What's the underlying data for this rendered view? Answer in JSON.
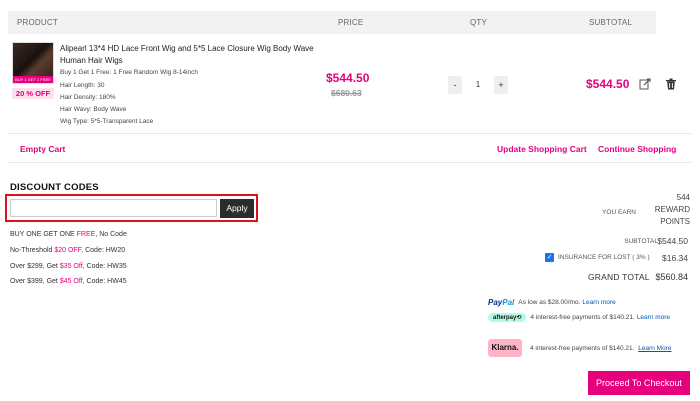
{
  "table": {
    "headers": [
      "PRODUCT",
      "PRICE",
      "QTY",
      "SUBTOTAL"
    ]
  },
  "product": {
    "name": "Alipearl 13*4 HD Lace Front Wig and 5*5 Lace Closure Wig Body Wave Human Hair Wigs",
    "image_ribbon": "BUY 1 GET 1 FREE",
    "discount_tag": "20 % OFF",
    "options": [
      "Buy 1 Get 1 Free: 1 Free Random Wig 8-14inch",
      "Hair Length: 30",
      "Hair Density: 180%",
      "Hair Wavy: Body Wave",
      "Wig Type: 5*5-Transparent Lace"
    ],
    "price": "$544.50",
    "original_price": "$680.63",
    "qty": "1",
    "qty_minus": "-",
    "qty_plus": "+",
    "subtotal": "$544.50",
    "icons": [
      "edit-icon",
      "trash-icon"
    ]
  },
  "actions": {
    "empty_cart": "Empty Cart",
    "update_cart": "Update Shopping Cart",
    "continue_shopping": "Continue Shopping"
  },
  "discount": {
    "title": "DISCOUNT CODES",
    "placeholder": "",
    "apply": "Apply",
    "promos": [
      {
        "pre": "BUY ONE GET ONE ",
        "hl": "FREE",
        "post": ", No Code"
      },
      {
        "pre": "No-Threshold ",
        "hl": "$20 OFF",
        "post": ", Code: HW20"
      },
      {
        "pre": "Over $299, Get ",
        "hl": "$35 Off",
        "post": ", Code: HW35"
      },
      {
        "pre": "Over $399, Get ",
        "hl": "$45 Off",
        "post": ", Code: HW45"
      }
    ]
  },
  "summary": {
    "reward_points": "544",
    "reward_text": "REWARD POINTS",
    "you_earn": "YOU EARN",
    "subtotal_label": "SUBTOTAL",
    "subtotal_value": "$544.50",
    "insurance_label": "INSURANCE FOR LOST ( 3% )",
    "insurance_value": "$16.34",
    "grand_total_label": "GRAND TOTAL",
    "grand_total_value": "$560.84"
  },
  "payments": {
    "paypal_brand_a": "Pay",
    "paypal_brand_b": "Pal",
    "paypal_text": "As low as $28.00/mo.",
    "afterpay_brand": "afterpay⟲",
    "afterpay_text": "4 interest-free payments of $140.21.",
    "klarna_brand": "Klarna.",
    "klarna_text": "4 interest-free payments of $140.21.",
    "learn_more": "Learn more",
    "learn_more_alt": "Learn More"
  },
  "checkout": "Proceed To Checkout",
  "colors": {
    "accent": "#e6007e",
    "highlight_border": "#e0101a"
  }
}
